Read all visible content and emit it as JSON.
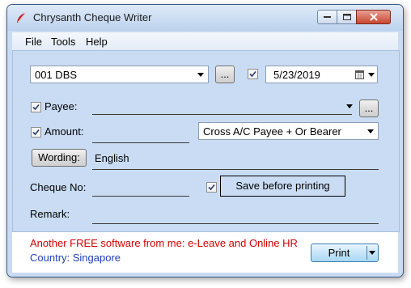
{
  "window": {
    "title": "Chrysanth Cheque Writer"
  },
  "menu": {
    "items": [
      "File",
      "Tools",
      "Help"
    ]
  },
  "bank": {
    "selected": "001 DBS",
    "browse_label": "..."
  },
  "date": {
    "checked": true,
    "value": "5/23/2019"
  },
  "payee": {
    "label": "Payee:",
    "checked": true,
    "value": "",
    "browse_label": "..."
  },
  "amount": {
    "label": "Amount:",
    "checked": true,
    "value": "",
    "crossing_selected": "Cross A/C Payee + Or Bearer"
  },
  "wording": {
    "button_label": "Wording:",
    "value": "English"
  },
  "cheque": {
    "label": "Cheque No:",
    "value": "",
    "save_checked": true,
    "save_label": "Save before printing"
  },
  "remark": {
    "label": "Remark:",
    "value": ""
  },
  "footer": {
    "promo": "Another FREE software from me: e-Leave and Online HR",
    "country": "Country: Singapore",
    "print_label": "Print",
    "promo_color": "#d40000",
    "country_color": "#1f3fbf"
  }
}
